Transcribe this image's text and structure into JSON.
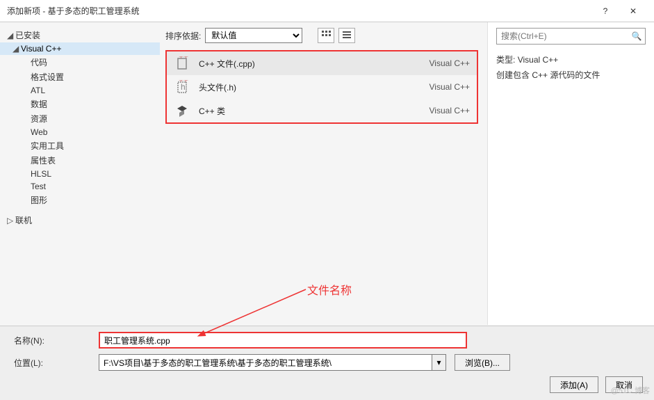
{
  "titlebar": {
    "title": "添加新项 - 基于多态的职工管理系统",
    "help": "?",
    "close": "✕"
  },
  "sidebar": {
    "installed": "已安装",
    "vcpp": "Visual C++",
    "items": [
      "代码",
      "格式设置",
      "ATL",
      "数据",
      "资源",
      "Web",
      "实用工具",
      "属性表",
      "HLSL",
      "Test",
      "图形"
    ],
    "online": "联机"
  },
  "toolbar": {
    "sort_label": "排序依据:",
    "sort_value": "默认值"
  },
  "list": {
    "rows": [
      {
        "name": "C++ 文件(.cpp)",
        "cat": "Visual C++"
      },
      {
        "name": "头文件(.h)",
        "cat": "Visual C++"
      },
      {
        "name": "C++ 类",
        "cat": "Visual C++"
      }
    ]
  },
  "search": {
    "placeholder": "搜索(Ctrl+E)"
  },
  "sideinfo": {
    "type_label": "类型:",
    "type_value": "Visual C++",
    "desc": "创建包含 C++ 源代码的文件"
  },
  "form": {
    "name_label": "名称(N):",
    "name_value": "职工管理系统.cpp",
    "loc_label": "位置(L):",
    "loc_value": "F:\\VS项目\\基于多态的职工管理系统\\基于多态的职工管理系统\\",
    "browse": "浏览(B)..."
  },
  "footer": {
    "add": "添加(A)",
    "cancel": "取消"
  },
  "annotation": {
    "label": "文件名称"
  },
  "watermark": "@51C 博客"
}
